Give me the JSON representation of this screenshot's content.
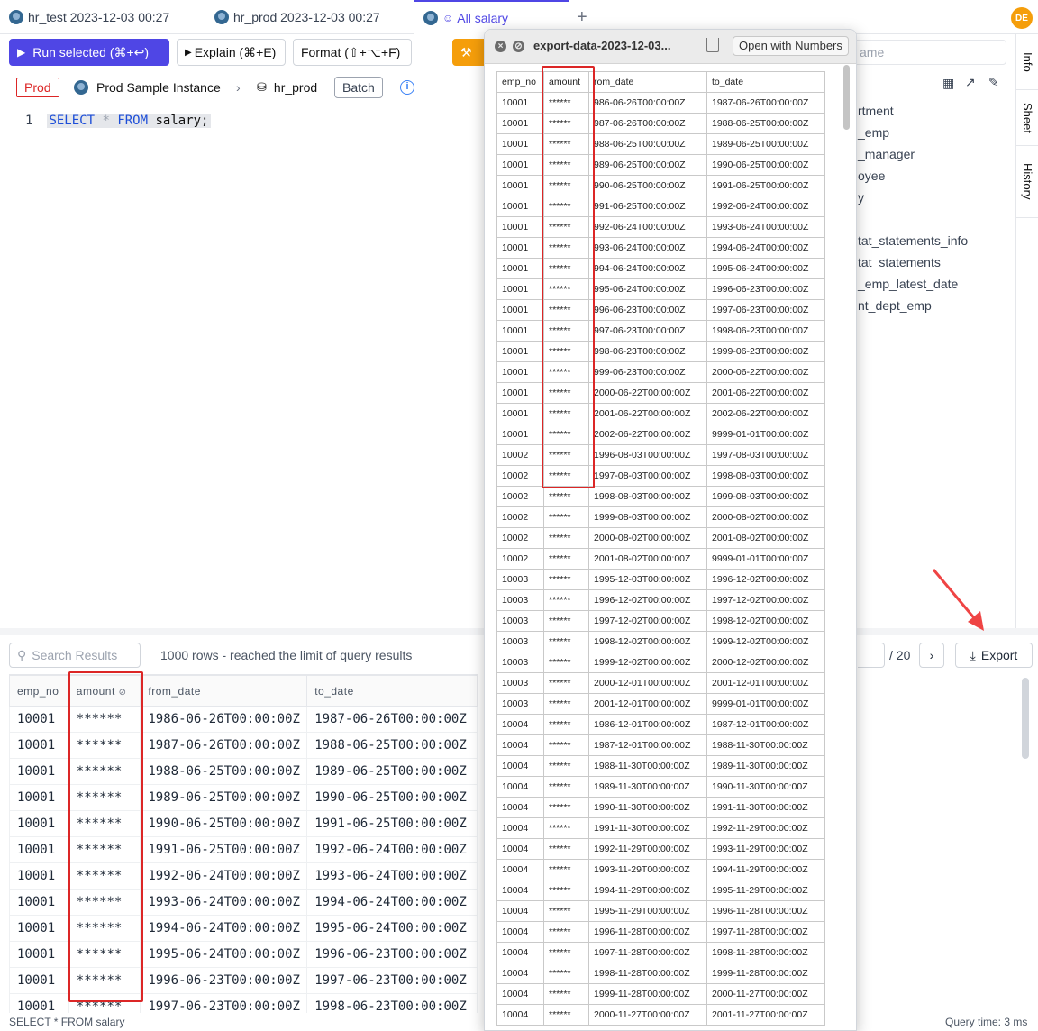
{
  "tabs": [
    {
      "label": "hr_test 2023-12-03 00:27"
    },
    {
      "label": "hr_prod 2023-12-03 00:27"
    },
    {
      "label": "All salary"
    }
  ],
  "user_initials": "DE",
  "toolbar": {
    "run_label": "Run selected (⌘+↩)",
    "explain_label": "Explain (⌘+E)",
    "format_label": "Format (⇧+⌥+F)"
  },
  "env": {
    "badge": "Prod",
    "instance": "Prod Sample Instance",
    "database": "hr_prod",
    "batch": "Batch"
  },
  "editor": {
    "line_no": "1",
    "kw1": "SELECT",
    "star": "*",
    "kw2": "FROM",
    "rest": "salary;"
  },
  "side_tabs": [
    "Info",
    "Sheet",
    "History"
  ],
  "schema_search_placeholder": "ame",
  "schema_items": [
    "rtment",
    "_emp",
    "_manager",
    "oyee",
    "y",
    "tat_statements_info",
    "tat_statements",
    "_emp_latest_date",
    "nt_dept_emp"
  ],
  "results": {
    "search_placeholder": "Search Results",
    "rows_info": "1000 rows  -  reached the limit of query results",
    "page_total": "/ 20",
    "export_label": "Export",
    "columns": [
      "emp_no",
      "amount",
      "from_date",
      "to_date"
    ],
    "rows": [
      [
        "10001",
        "******",
        "1986-06-26T00:00:00Z",
        "1987-06-26T00:00:00Z"
      ],
      [
        "10001",
        "******",
        "1987-06-26T00:00:00Z",
        "1988-06-25T00:00:00Z"
      ],
      [
        "10001",
        "******",
        "1988-06-25T00:00:00Z",
        "1989-06-25T00:00:00Z"
      ],
      [
        "10001",
        "******",
        "1989-06-25T00:00:00Z",
        "1990-06-25T00:00:00Z"
      ],
      [
        "10001",
        "******",
        "1990-06-25T00:00:00Z",
        "1991-06-25T00:00:00Z"
      ],
      [
        "10001",
        "******",
        "1991-06-25T00:00:00Z",
        "1992-06-24T00:00:00Z"
      ],
      [
        "10001",
        "******",
        "1992-06-24T00:00:00Z",
        "1993-06-24T00:00:00Z"
      ],
      [
        "10001",
        "******",
        "1993-06-24T00:00:00Z",
        "1994-06-24T00:00:00Z"
      ],
      [
        "10001",
        "******",
        "1994-06-24T00:00:00Z",
        "1995-06-24T00:00:00Z"
      ],
      [
        "10001",
        "******",
        "1995-06-24T00:00:00Z",
        "1996-06-23T00:00:00Z"
      ],
      [
        "10001",
        "******",
        "1996-06-23T00:00:00Z",
        "1997-06-23T00:00:00Z"
      ],
      [
        "10001",
        "******",
        "1997-06-23T00:00:00Z",
        "1998-06-23T00:00:00Z"
      ]
    ],
    "status_sql": "SELECT * FROM salary",
    "query_time": "Query time: 3 ms"
  },
  "popup": {
    "title": "export-data-2023-12-03...",
    "open_with": "Open with Numbers",
    "columns": [
      "emp_no",
      "amount",
      "rom_date",
      "to_date"
    ],
    "rows": [
      [
        "10001",
        "******",
        "986-06-26T00:00:00Z",
        "1987-06-26T00:00:00Z"
      ],
      [
        "10001",
        "******",
        "987-06-26T00:00:00Z",
        "1988-06-25T00:00:00Z"
      ],
      [
        "10001",
        "******",
        "988-06-25T00:00:00Z",
        "1989-06-25T00:00:00Z"
      ],
      [
        "10001",
        "******",
        "989-06-25T00:00:00Z",
        "1990-06-25T00:00:00Z"
      ],
      [
        "10001",
        "******",
        "990-06-25T00:00:00Z",
        "1991-06-25T00:00:00Z"
      ],
      [
        "10001",
        "******",
        "991-06-25T00:00:00Z",
        "1992-06-24T00:00:00Z"
      ],
      [
        "10001",
        "******",
        "992-06-24T00:00:00Z",
        "1993-06-24T00:00:00Z"
      ],
      [
        "10001",
        "******",
        "993-06-24T00:00:00Z",
        "1994-06-24T00:00:00Z"
      ],
      [
        "10001",
        "******",
        "994-06-24T00:00:00Z",
        "1995-06-24T00:00:00Z"
      ],
      [
        "10001",
        "******",
        "995-06-24T00:00:00Z",
        "1996-06-23T00:00:00Z"
      ],
      [
        "10001",
        "******",
        "996-06-23T00:00:00Z",
        "1997-06-23T00:00:00Z"
      ],
      [
        "10001",
        "******",
        "997-06-23T00:00:00Z",
        "1998-06-23T00:00:00Z"
      ],
      [
        "10001",
        "******",
        "998-06-23T00:00:00Z",
        "1999-06-23T00:00:00Z"
      ],
      [
        "10001",
        "******",
        "999-06-23T00:00:00Z",
        "2000-06-22T00:00:00Z"
      ],
      [
        "10001",
        "******",
        "2000-06-22T00:00:00Z",
        "2001-06-22T00:00:00Z"
      ],
      [
        "10001",
        "******",
        "2001-06-22T00:00:00Z",
        "2002-06-22T00:00:00Z"
      ],
      [
        "10001",
        "******",
        "2002-06-22T00:00:00Z",
        "9999-01-01T00:00:00Z"
      ],
      [
        "10002",
        "******",
        "1996-08-03T00:00:00Z",
        "1997-08-03T00:00:00Z"
      ],
      [
        "10002",
        "******",
        "1997-08-03T00:00:00Z",
        "1998-08-03T00:00:00Z"
      ],
      [
        "10002",
        "******",
        "1998-08-03T00:00:00Z",
        "1999-08-03T00:00:00Z"
      ],
      [
        "10002",
        "******",
        "1999-08-03T00:00:00Z",
        "2000-08-02T00:00:00Z"
      ],
      [
        "10002",
        "******",
        "2000-08-02T00:00:00Z",
        "2001-08-02T00:00:00Z"
      ],
      [
        "10002",
        "******",
        "2001-08-02T00:00:00Z",
        "9999-01-01T00:00:00Z"
      ],
      [
        "10003",
        "******",
        "1995-12-03T00:00:00Z",
        "1996-12-02T00:00:00Z"
      ],
      [
        "10003",
        "******",
        "1996-12-02T00:00:00Z",
        "1997-12-02T00:00:00Z"
      ],
      [
        "10003",
        "******",
        "1997-12-02T00:00:00Z",
        "1998-12-02T00:00:00Z"
      ],
      [
        "10003",
        "******",
        "1998-12-02T00:00:00Z",
        "1999-12-02T00:00:00Z"
      ],
      [
        "10003",
        "******",
        "1999-12-02T00:00:00Z",
        "2000-12-02T00:00:00Z"
      ],
      [
        "10003",
        "******",
        "2000-12-01T00:00:00Z",
        "2001-12-01T00:00:00Z"
      ],
      [
        "10003",
        "******",
        "2001-12-01T00:00:00Z",
        "9999-01-01T00:00:00Z"
      ],
      [
        "10004",
        "******",
        "1986-12-01T00:00:00Z",
        "1987-12-01T00:00:00Z"
      ],
      [
        "10004",
        "******",
        "1987-12-01T00:00:00Z",
        "1988-11-30T00:00:00Z"
      ],
      [
        "10004",
        "******",
        "1988-11-30T00:00:00Z",
        "1989-11-30T00:00:00Z"
      ],
      [
        "10004",
        "******",
        "1989-11-30T00:00:00Z",
        "1990-11-30T00:00:00Z"
      ],
      [
        "10004",
        "******",
        "1990-11-30T00:00:00Z",
        "1991-11-30T00:00:00Z"
      ],
      [
        "10004",
        "******",
        "1991-11-30T00:00:00Z",
        "1992-11-29T00:00:00Z"
      ],
      [
        "10004",
        "******",
        "1992-11-29T00:00:00Z",
        "1993-11-29T00:00:00Z"
      ],
      [
        "10004",
        "******",
        "1993-11-29T00:00:00Z",
        "1994-11-29T00:00:00Z"
      ],
      [
        "10004",
        "******",
        "1994-11-29T00:00:00Z",
        "1995-11-29T00:00:00Z"
      ],
      [
        "10004",
        "******",
        "1995-11-29T00:00:00Z",
        "1996-11-28T00:00:00Z"
      ],
      [
        "10004",
        "******",
        "1996-11-28T00:00:00Z",
        "1997-11-28T00:00:00Z"
      ],
      [
        "10004",
        "******",
        "1997-11-28T00:00:00Z",
        "1998-11-28T00:00:00Z"
      ],
      [
        "10004",
        "******",
        "1998-11-28T00:00:00Z",
        "1999-11-28T00:00:00Z"
      ],
      [
        "10004",
        "******",
        "1999-11-28T00:00:00Z",
        "2000-11-27T00:00:00Z"
      ],
      [
        "10004",
        "******",
        "2000-11-27T00:00:00Z",
        "2001-11-27T00:00:00Z"
      ]
    ]
  },
  "colors": {
    "accent": "#4f46e5",
    "danger": "#dc2626",
    "warning": "#f59e0b"
  }
}
